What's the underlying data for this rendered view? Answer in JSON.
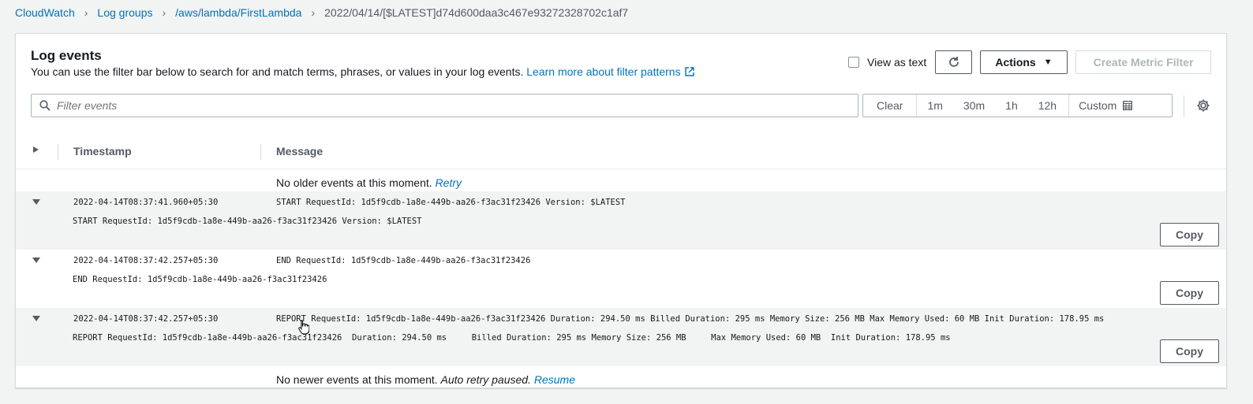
{
  "breadcrumb": {
    "items": [
      "CloudWatch",
      "Log groups",
      "/aws/lambda/FirstLambda"
    ],
    "current": "2022/04/14/[$LATEST]d74d600daa3c467e93272328702c1af7"
  },
  "header": {
    "title": "Log events",
    "description": "You can use the filter bar below to search for and match terms, phrases, or values in your log events.",
    "learn_more": "Learn more about filter patterns"
  },
  "toolbar": {
    "view_as_text": "View as text",
    "actions_label": "Actions",
    "create_metric_filter": "Create Metric Filter"
  },
  "search": {
    "placeholder": "Filter events"
  },
  "time_range": {
    "clear": "Clear",
    "options": [
      "1m",
      "30m",
      "1h",
      "12h"
    ],
    "custom": "Custom"
  },
  "table": {
    "columns": [
      "Timestamp",
      "Message"
    ]
  },
  "older": {
    "text": "No older events at this moment.",
    "retry": "Retry"
  },
  "newer": {
    "text": "No newer events at this moment.",
    "paused": "Auto retry paused.",
    "resume": "Resume"
  },
  "events": [
    {
      "timestamp": "2022-04-14T08:37:41.960+05:30",
      "message": "START RequestId: 1d5f9cdb-1a8e-449b-aa26-f3ac31f23426 Version: $LATEST",
      "detail": "START RequestId: 1d5f9cdb-1a8e-449b-aa26-f3ac31f23426 Version: $LATEST",
      "copy_label": "Copy"
    },
    {
      "timestamp": "2022-04-14T08:37:42.257+05:30",
      "message": "END RequestId: 1d5f9cdb-1a8e-449b-aa26-f3ac31f23426",
      "detail": "END RequestId: 1d5f9cdb-1a8e-449b-aa26-f3ac31f23426",
      "copy_label": "Copy"
    },
    {
      "timestamp": "2022-04-14T08:37:42.257+05:30",
      "message": "REPORT RequestId: 1d5f9cdb-1a8e-449b-aa26-f3ac31f23426 Duration: 294.50 ms Billed Duration: 295 ms Memory Size: 256 MB Max Memory Used: 60 MB Init Duration: 178.95 ms",
      "detail": "REPORT RequestId: 1d5f9cdb-1a8e-449b-aa26-f3ac31f23426  Duration: 294.50 ms     Billed Duration: 295 ms Memory Size: 256 MB     Max Memory Used: 60 MB  Init Duration: 178.95 ms",
      "copy_label": "Copy"
    }
  ],
  "colors": {
    "link": "#0073bb",
    "shaded_row": "#f2f3f3",
    "border": "#aab7b8"
  }
}
